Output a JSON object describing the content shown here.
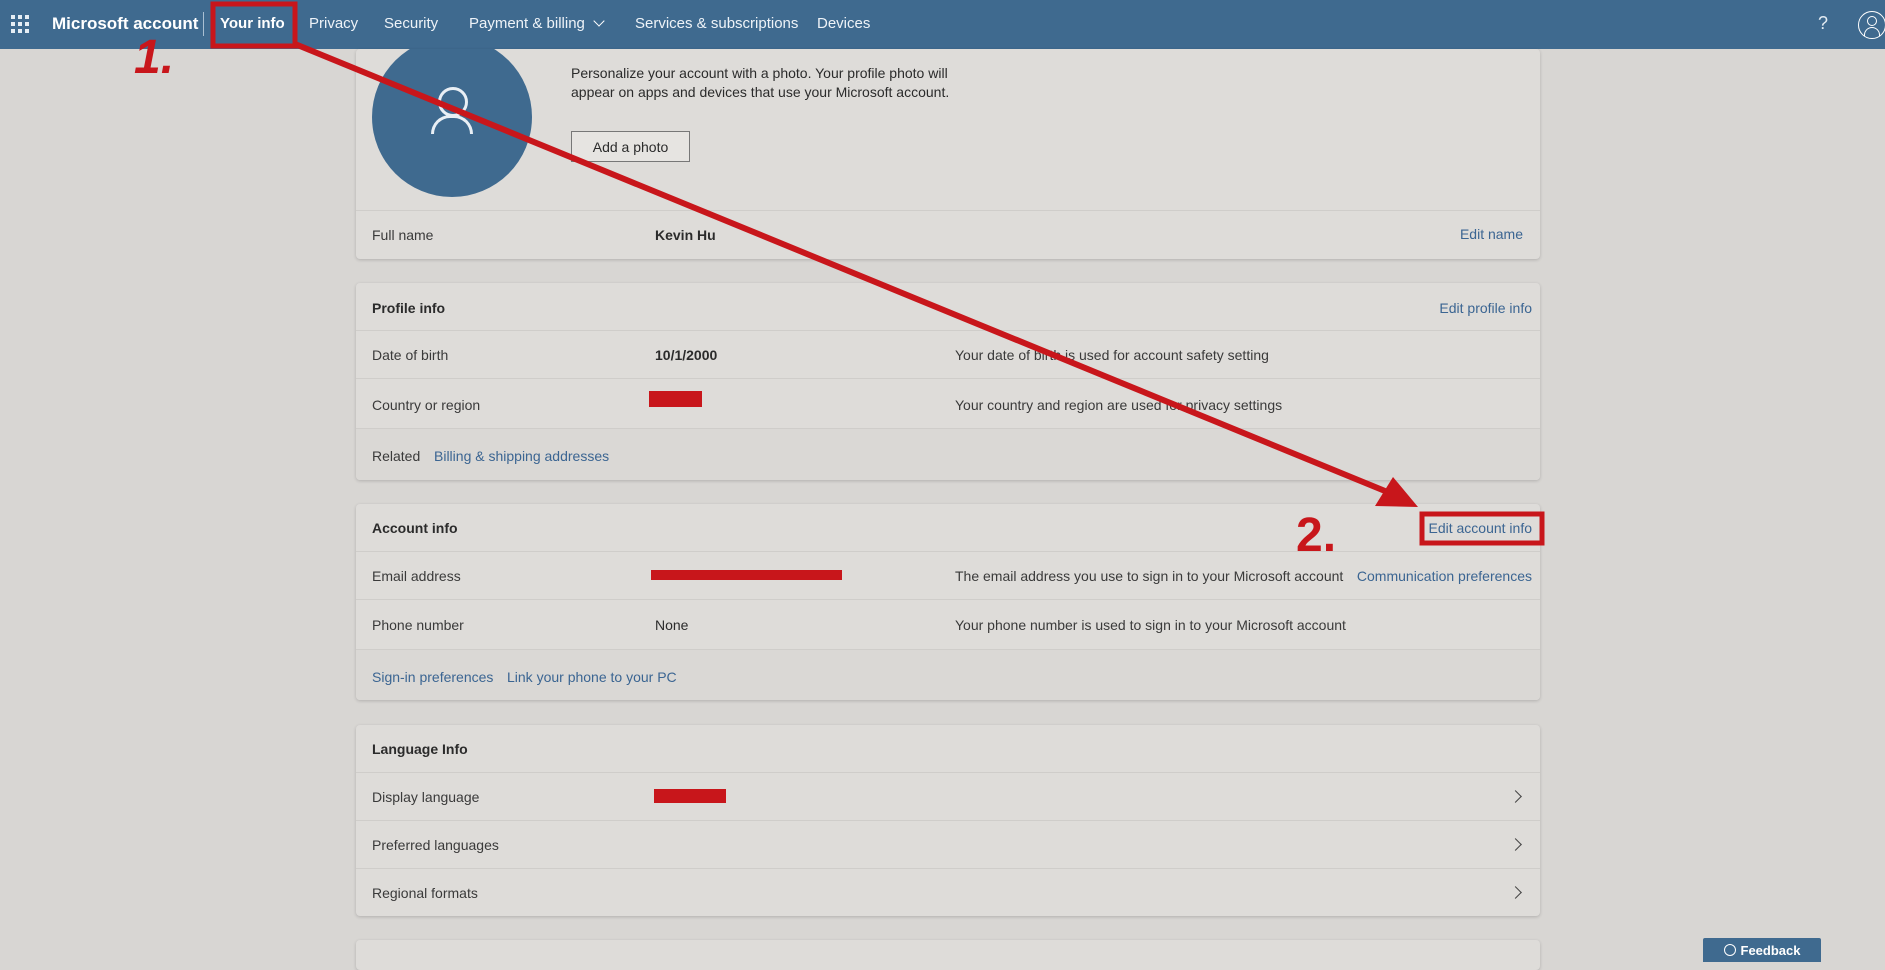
{
  "nav": {
    "brand": "Microsoft account",
    "items": [
      "Your info",
      "Privacy",
      "Security",
      "Payment & billing",
      "Services & subscriptions",
      "Devices"
    ],
    "help": "?"
  },
  "photo": {
    "text": "Personalize your account with a photo. Your profile photo will appear on apps and devices that use your Microsoft account.",
    "add_photo": "Add a photo",
    "full_name_label": "Full name",
    "full_name_value": "Kevin Hu",
    "edit_name": "Edit name"
  },
  "profile": {
    "title": "Profile info",
    "edit": "Edit profile info",
    "dob_label": "Date of birth",
    "dob_value": "10/1/2000",
    "dob_desc": "Your date of birth is used for account safety setting",
    "country_label": "Country or region",
    "country_desc": "Your country and region are used for privacy settings",
    "related_label": "Related",
    "related_link": "Billing & shipping addresses"
  },
  "account": {
    "title": "Account info",
    "edit": "Edit account info",
    "email_label": "Email address",
    "email_desc": "The email address you use to sign in to your Microsoft account",
    "comm_prefs": "Communication preferences",
    "phone_label": "Phone number",
    "phone_value": "None",
    "phone_desc": "Your phone number is used to sign in to your Microsoft account",
    "signin_prefs": "Sign-in preferences",
    "link_phone": "Link your phone to your PC"
  },
  "language": {
    "title": "Language Info",
    "display_label": "Display language",
    "preferred_label": "Preferred languages",
    "regional_label": "Regional formats"
  },
  "feedback": "Feedback",
  "annotations": {
    "step1": "1.",
    "step2": "2.",
    "color": "#c8161b"
  }
}
